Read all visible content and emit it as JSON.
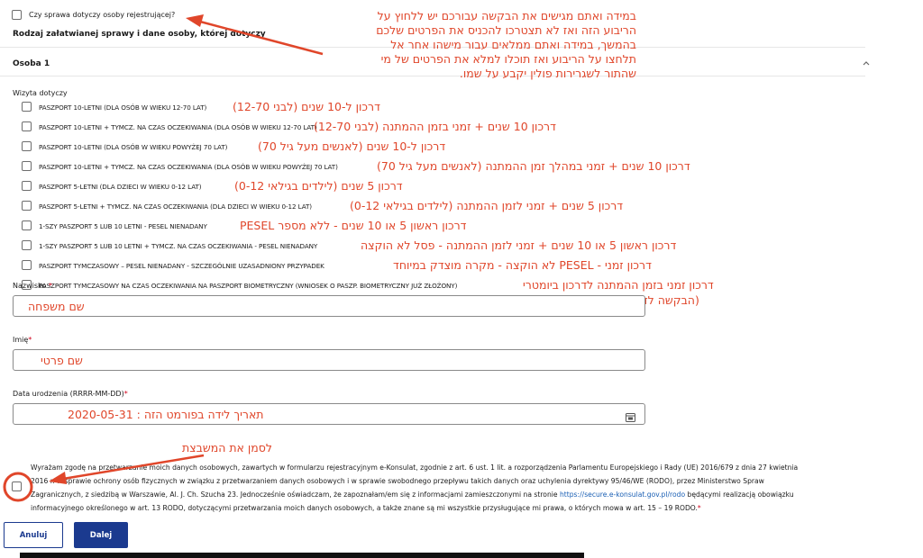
{
  "form": {
    "registrant_checkbox_label": "Czy sprawa dotyczy osoby rejestrującej?",
    "section_title": "Rodzaj załatwianej sprawy i dane osoby, której dotyczy",
    "person_label": "Osoba 1",
    "visit_label": "Wizyta dotyczy",
    "options": [
      "PASZPORT 10-LETNI (DLA OSÓB W WIEKU 12-70 LAT)",
      "PASZPORT 10-LETNI + TYMCZ. NA CZAS OCZEKIWANIA (DLA OSÓB W WIEKU 12-70 LAT)",
      "PASZPORT 10-LETNI (DLA OSÓB W WIEKU POWYŻEJ 70 LAT)",
      "PASZPORT 10-LETNI + TYMCZ. NA CZAS OCZEKIWANIA (DLA OSÓB W WIEKU POWYŻEJ 70 LAT)",
      "PASZPORT 5-LETNI (DLA DZIECI W WIEKU 0-12 LAT)",
      "PASZPORT 5-LETNI + TYMCZ. NA CZAS OCZEKIWANIA (DLA DZIECI W WIEKU 0-12 LAT)",
      "1-SZY PASZPORT 5 LUB 10 LETNI - PESEL NIENADANY",
      "1-SZY PASZPORT 5 LUB 10 LETNI + TYMCZ. NA CZAS OCZEKIWANIA - PESEL NIENADANY",
      "PASZPORT TYMCZASOWY – PESEL NIENADANY - SZCZEGÓLNIE UZASADNIONY PRZYPADEK",
      "PASZPORT TYMCZASOWY NA CZAS OCZEKIWANIA NA PASZPORT BIOMETRYCZNY (WNIOSEK O PASZP. BIOMETRYCZNY JUŻ ZŁOŻONY)"
    ],
    "surname_label": "Nazwisko",
    "firstname_label": "Imię",
    "dob_label": "Data urodzenia (RRRR-MM-DD)",
    "required_mark": "*",
    "consent_line1": "Wyrażam zgodę na przetwarzanie moich danych osobowych, zawartych w formularzu rejestracyjnym e-Konsulat, zgodnie z art. 6 ust. 1 lit. a rozporządzenia Parlamentu Europejskiego i Rady (UE) 2016/679 z dnia 27 kwietnia",
    "consent_line2": "2016 r. w sprawie ochrony osób fizycznych w związku z przetwarzaniem danych osobowych i w sprawie swobodnego przepływu takich danych oraz uchylenia dyrektywy 95/46/WE (RODO), przez Ministerstwo Spraw",
    "consent_line3_pre": "Zagranicznych, z siedzibą w Warszawie, Al. J. Ch. Szucha 23. Jednocześnie oświadczam, że zapoznałam/em się z informacjami zamieszczonymi na stronie",
    "consent_link": "https://secure.e-konsulat.gov.pl/rodo",
    "consent_line3_post": "będącymi realizacją obowiązku",
    "consent_line4": "informacyjnego określonego w art. 13 RODO, dotyczącymi przetwarzania moich danych osobowych, a także znane są mi wszystkie przysługujące mi prawa, o których mowa w art. 15 – 19 RODO.",
    "cancel_label": "Anuluj",
    "next_label": "Dalej"
  },
  "annotations": {
    "top_note": [
      "במידה ואתם מגישים את הבקשה עבורכם יש ללחוץ על",
      "הריבוע הזה ואז לא תצטרכו להכניס את הפרטים שלכם",
      "בהמשך, במידה ואתם ממלאים עבור מישהו אחר אל",
      "תלחצו על הריבוע ואז תוכלו למלא את הפרטים של מי",
      "שהתור לשגרירות פולין יקבע על שמו."
    ],
    "options": [
      "דרכון ל-10 שנים (לבני 12-70)",
      "דרכון 10 שנים + זמני בזמן ההמתנה (לבני 12-70)",
      "דרכון ל-10 שנים (לאנשים מעל גיל 70)",
      "דרכון 10 שנים + זמני במהלך זמן ההמתנה (לאנשים מעל גיל 70)",
      "דרכון 5 שנים (לילדים בגילאי 0-12)",
      "דרכון 5 שנים + זמני לזמן ההמתנה (לילדים בגילאי 0-12)",
      "דרכון ראשון 5 או 10 שנים - ללא מספר PESEL",
      "דרכון ראשון 5 או 10 שנים + זמני לזמן ההמתנה - פסל לא הוקצה",
      "דרכון זמני - PESEL לא הוקצה - מקרה מוצדק במיוחד",
      "דרכון זמני בזמן ההמתנה לדרכון ביומטרי"
    ],
    "option_last_extra": "(הבקשה לדרכון ביומטרי כבר הוגשה)",
    "surname_hint": "שם משפחה",
    "firstname_hint": "שם פרטי",
    "dob_hint": "תאריך לידה בפורמט הזה : 2020-05-31",
    "consent_hint": "לסמן את המשבצת"
  },
  "colors": {
    "annotation": "#e0462a",
    "primary": "#1b3a8f"
  }
}
